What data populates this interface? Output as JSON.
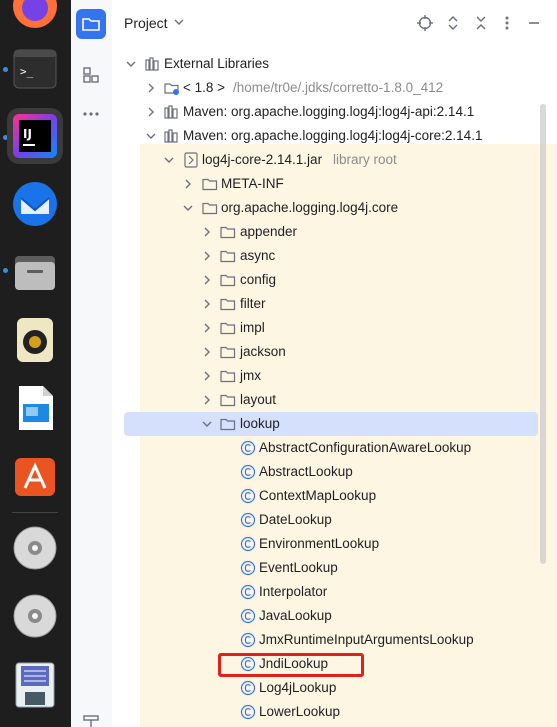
{
  "dock": {
    "apps": [
      {
        "name": "firefox",
        "active": false
      },
      {
        "name": "terminal",
        "active": false
      },
      {
        "name": "intellij",
        "active": true
      },
      {
        "name": "thunderbird",
        "active": false
      },
      {
        "name": "files",
        "active": false
      },
      {
        "name": "rhythmbox",
        "active": false
      },
      {
        "name": "libreoffice-impress",
        "active": false
      },
      {
        "name": "app-center",
        "active": false
      },
      {
        "name": "disc-1",
        "active": false
      },
      {
        "name": "disc-2",
        "active": false
      },
      {
        "name": "floppy",
        "active": false
      }
    ],
    "intellij_label": "IJ"
  },
  "panel": {
    "title": "Project"
  },
  "tree": {
    "rows": [
      {
        "id": "external-libraries",
        "label": "External Libraries",
        "suffix": "",
        "expanded": true
      },
      {
        "id": "jdk",
        "label": "< 1.8 >",
        "suffix": "/home/tr0e/.jdks/corretto-1.8.0_412",
        "expanded": false
      },
      {
        "id": "maven-api",
        "label": "Maven: org.apache.logging.log4j:log4j-api:2.14.1",
        "suffix": "",
        "expanded": false
      },
      {
        "id": "maven-core",
        "label": "Maven: org.apache.logging.log4j:log4j-core:2.14.1",
        "suffix": "",
        "expanded": true
      },
      {
        "id": "core-jar",
        "label": "log4j-core-2.14.1.jar",
        "suffix": "library root",
        "expanded": true
      },
      {
        "id": "meta-inf",
        "label": "META-INF",
        "suffix": "",
        "expanded": false
      },
      {
        "id": "pkg-core",
        "label": "org.apache.logging.log4j.core",
        "suffix": "",
        "expanded": true
      },
      {
        "id": "appender",
        "label": "appender",
        "suffix": "",
        "expanded": false
      },
      {
        "id": "async",
        "label": "async",
        "suffix": "",
        "expanded": false
      },
      {
        "id": "config",
        "label": "config",
        "suffix": "",
        "expanded": false
      },
      {
        "id": "filter",
        "label": "filter",
        "suffix": "",
        "expanded": false
      },
      {
        "id": "impl",
        "label": "impl",
        "suffix": "",
        "expanded": false
      },
      {
        "id": "jackson",
        "label": "jackson",
        "suffix": "",
        "expanded": false
      },
      {
        "id": "jmx",
        "label": "jmx",
        "suffix": "",
        "expanded": false
      },
      {
        "id": "layout",
        "label": "layout",
        "suffix": "",
        "expanded": false
      },
      {
        "id": "lookup",
        "label": "lookup",
        "suffix": "",
        "expanded": true
      },
      {
        "id": "c1",
        "label": "AbstractConfigurationAwareLookup",
        "suffix": ""
      },
      {
        "id": "c2",
        "label": "AbstractLookup",
        "suffix": ""
      },
      {
        "id": "c3",
        "label": "ContextMapLookup",
        "suffix": ""
      },
      {
        "id": "c4",
        "label": "DateLookup",
        "suffix": ""
      },
      {
        "id": "c5",
        "label": "EnvironmentLookup",
        "suffix": ""
      },
      {
        "id": "c6",
        "label": "EventLookup",
        "suffix": ""
      },
      {
        "id": "c7",
        "label": "Interpolator",
        "suffix": ""
      },
      {
        "id": "c8",
        "label": "JavaLookup",
        "suffix": ""
      },
      {
        "id": "c9",
        "label": "JmxRuntimeInputArgumentsLookup",
        "suffix": ""
      },
      {
        "id": "c10",
        "label": "JndiLookup",
        "suffix": ""
      },
      {
        "id": "c11",
        "label": "Log4jLookup",
        "suffix": ""
      },
      {
        "id": "c12",
        "label": "LowerLookup",
        "suffix": ""
      }
    ],
    "selected": "lookup",
    "highlighted": "JndiLookup"
  },
  "colors": {
    "selection": "#d5e1fc",
    "library_bg": "#fdf6e3",
    "highlight_border": "#e0201b",
    "accent": "#3574f0"
  }
}
